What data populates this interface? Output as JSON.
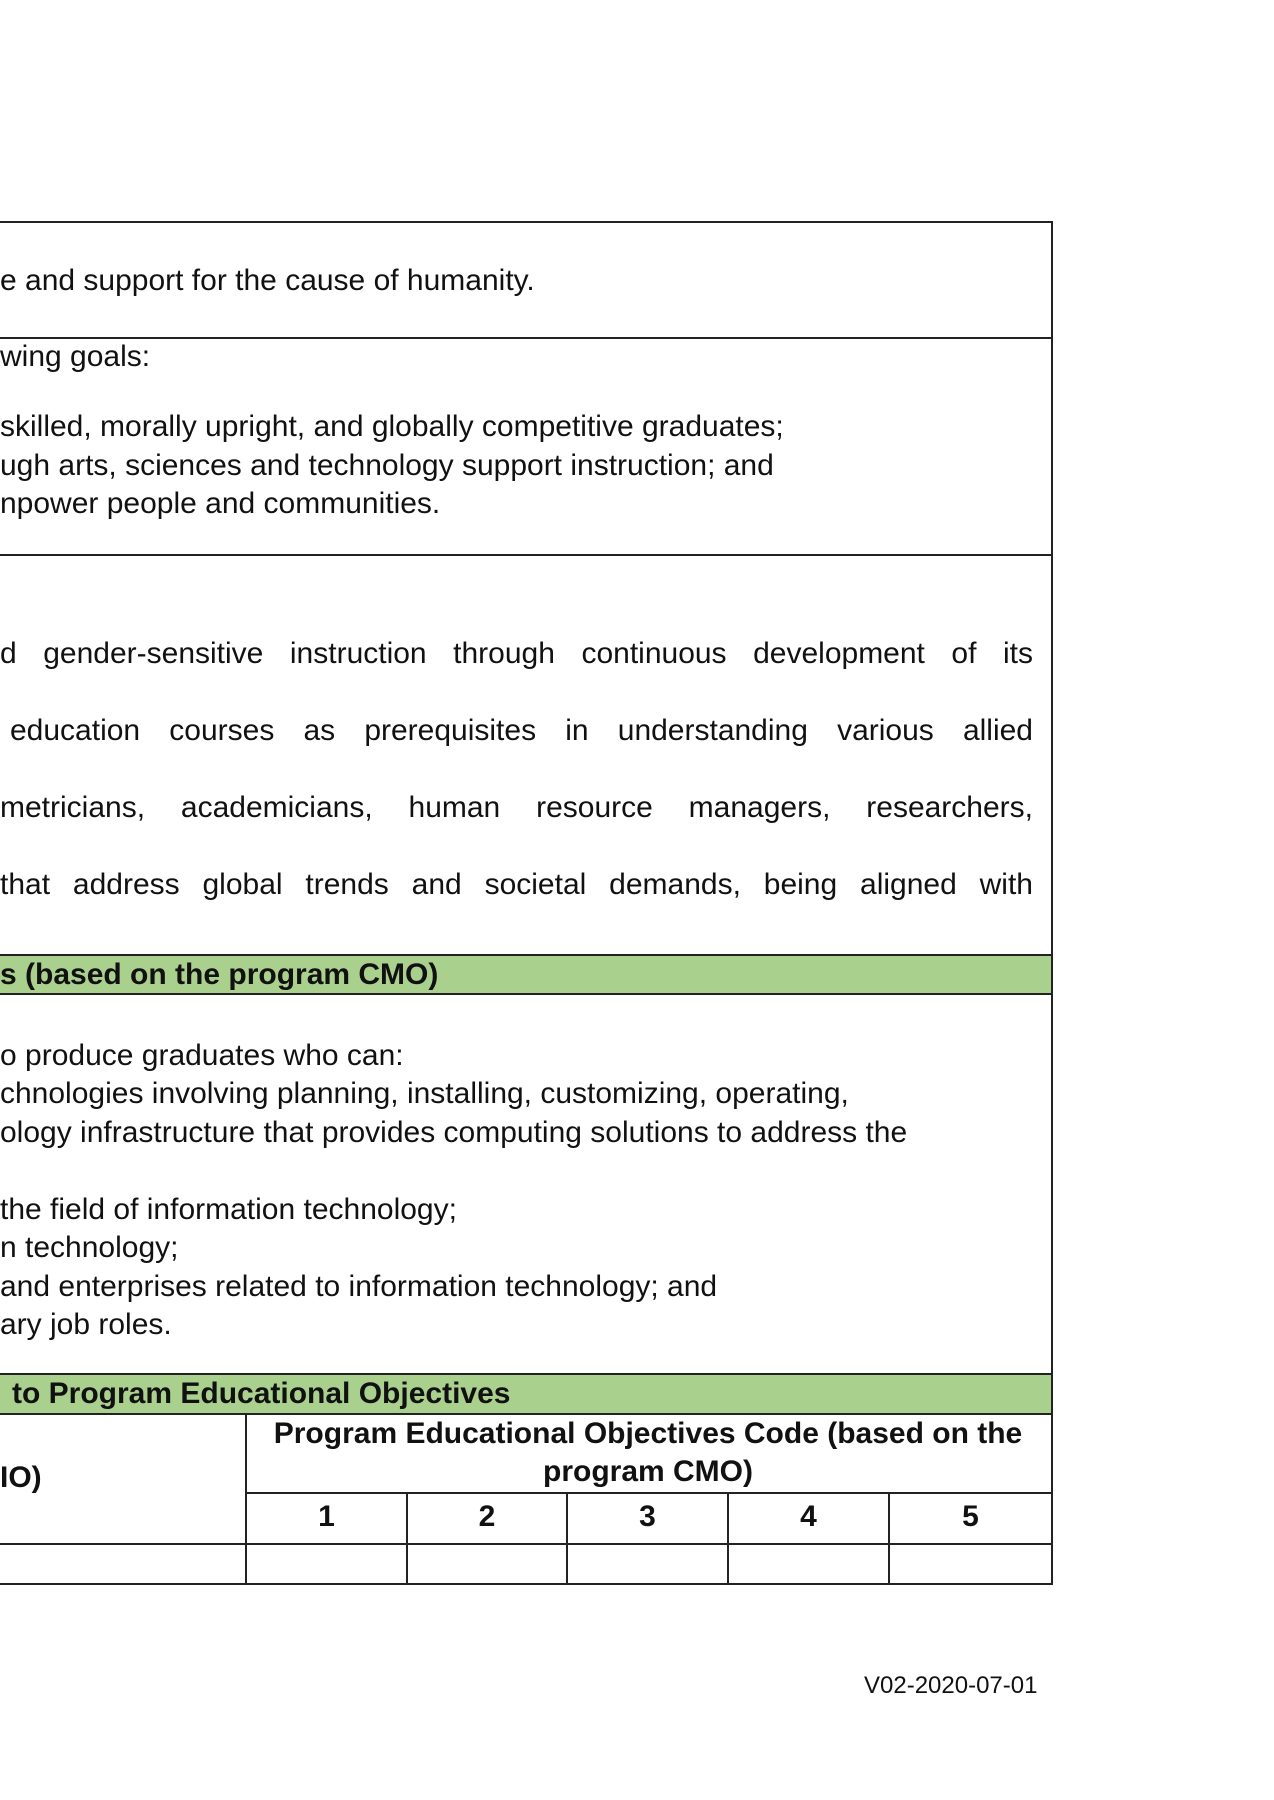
{
  "vision_tail": "e and support for the cause of  humanity.",
  "goals": {
    "intro": "wing goals:",
    "items": [
      "skilled, morally upright, and globally competitive graduates;",
      "ugh arts, sciences and technology support instruction; and",
      "npower people and communities."
    ]
  },
  "objectives_lines": [
    "d gender-sensitive instruction through continuous development of its",
    "education courses as prerequisites in understanding various allied",
    "metricians, academicians, human resource managers, researchers,",
    "that address global trends and societal demands, being aligned with"
  ],
  "peo_section": {
    "title": "s (based on the program CMO)",
    "lines": [
      "o produce graduates who can:",
      "chnologies involving planning, installing, customizing, operating,",
      "ology infrastructure that provides computing solutions to address the",
      "the field of information technology;",
      "n technology;",
      "and enterprises related to information technology; and",
      "ary job roles."
    ]
  },
  "mapping_section": {
    "title": "to Program Educational Objectives",
    "left_header": "IO)",
    "right_header": "Program Educational Objectives Code (based on the program CMO)",
    "columns": [
      "1",
      "2",
      "3",
      "4",
      "5"
    ]
  },
  "footer": {
    "version": "V02-2020-07-01"
  }
}
